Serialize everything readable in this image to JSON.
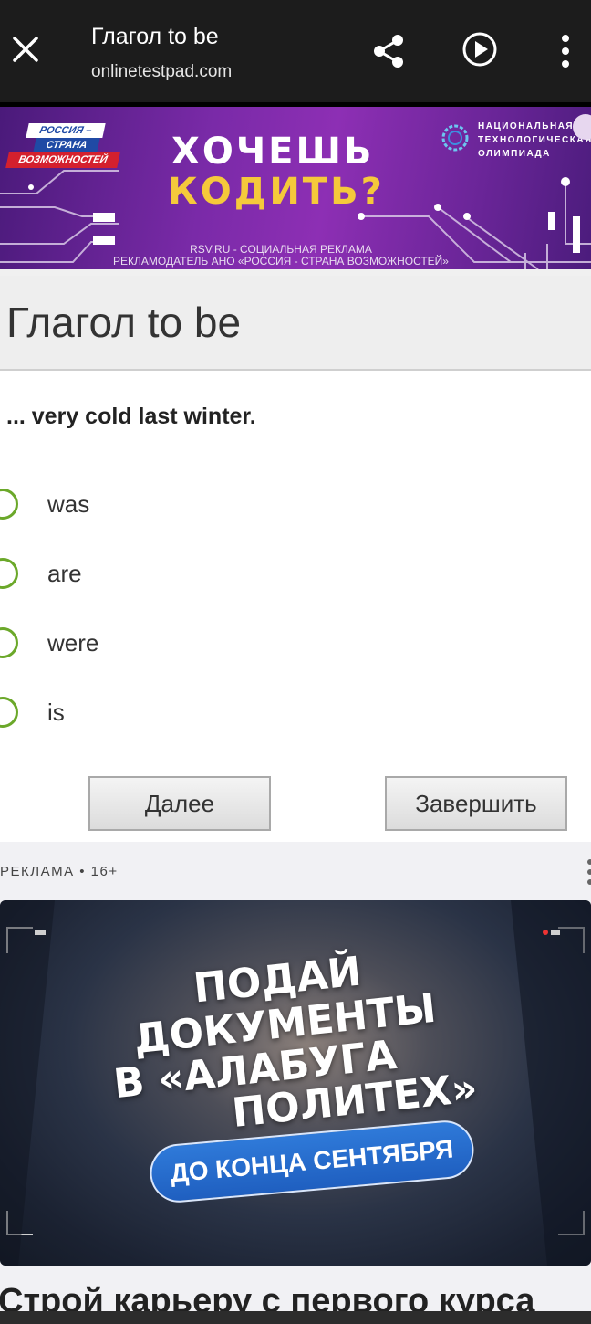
{
  "topbar": {
    "title": "Глагол to be",
    "url": "onlinetestpad.com",
    "icons": [
      "close-icon",
      "share-icon",
      "play-icon",
      "more-vert-icon"
    ]
  },
  "banner_ad": {
    "badge": [
      "РОССИЯ –",
      "СТРАНА",
      "ВОЗМОЖНОСТЕЙ"
    ],
    "headline_line1": "ХОЧЕШЬ",
    "headline_line2": "КОДИТЬ?",
    "org": [
      "НАЦИОНАЛЬНАЯ",
      "ТЕХНОЛОГИЧЕСКАЯ",
      "ОЛИМПИАДА"
    ],
    "disclaimer_line1": "RSV.RU - СОЦИАЛЬНАЯ РЕКЛАМА",
    "disclaimer_line2": "РЕКЛАМОДАТЕЛЬ АНО «РОССИЯ - СТРАНА ВОЗМОЖНОСТЕЙ»",
    "colors": {
      "background": "#7a2aa8",
      "headline_accent": "#f5c93b"
    }
  },
  "test": {
    "title": "Глагол to be",
    "question": "... very cold last winter.",
    "options": [
      "was",
      "are",
      "were",
      "is"
    ],
    "next_button": "Далее",
    "finish_button": "Завершить",
    "colors": {
      "radio_border": "#6ba82a"
    }
  },
  "bottom_ad": {
    "label": "РЕКЛАМА • 16+",
    "line1": "ПОДАЙ",
    "line2": "ДОКУМЕНТЫ",
    "line3": "В «АЛАБУГА",
    "line4": "ПОЛИТЕХ»",
    "pill": "ДО КОНЦА СЕНТЯБРЯ",
    "caption": "Строй карьеру с первого курса",
    "colors": {
      "pill": "#2f7ad9"
    }
  }
}
